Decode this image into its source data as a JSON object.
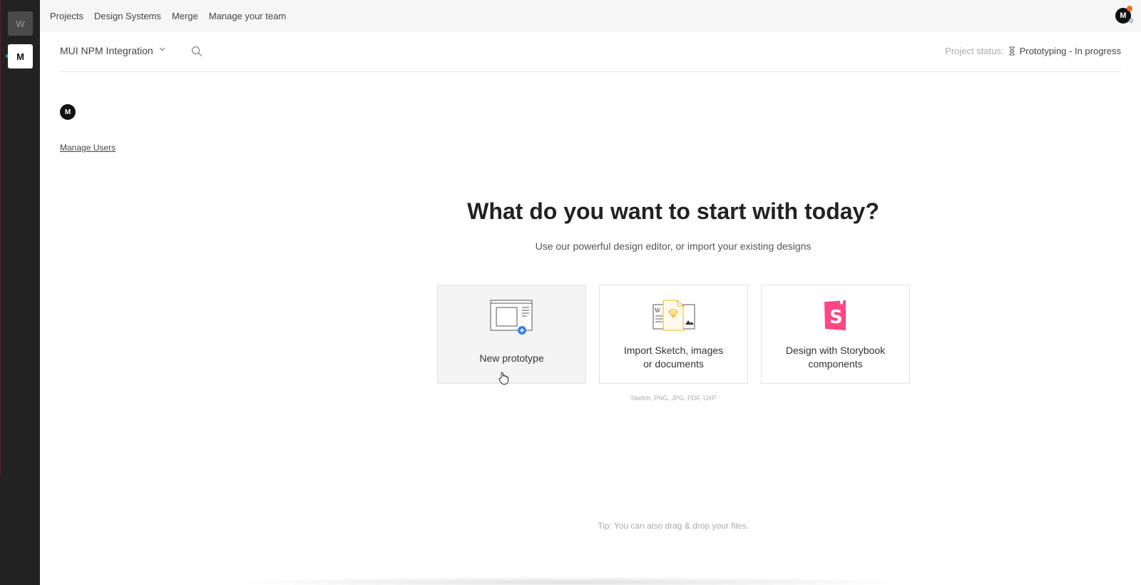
{
  "workspaces": [
    {
      "initial": "W"
    },
    {
      "initial": "M"
    }
  ],
  "topnav": {
    "items": [
      "Projects",
      "Design Systems",
      "Merge",
      "Manage your team"
    ],
    "user_initial": "M"
  },
  "project": {
    "name": "MUI NPM Integration",
    "status_label": "Project status:",
    "status_value": "Prototyping - In progress"
  },
  "members": {
    "initial": "M",
    "manage_link": "Manage Users"
  },
  "hero": {
    "title": "What do you want to start with today?",
    "subtitle": "Use our powerful design editor, or import your existing designs"
  },
  "cards": [
    {
      "label": "New prototype",
      "icon": "prototype-icon"
    },
    {
      "label": "Import Sketch, images or documents",
      "line1": "Import Sketch, images",
      "line2": "or documents",
      "icon": "import-files-icon"
    },
    {
      "label": "Design with Storybook components",
      "line1": "Design with Storybook",
      "line2": "components",
      "icon": "storybook-icon"
    }
  ],
  "import_formats": "Sketch, PNG, JPG, PDF, UXP",
  "tip": "Tip: You can also drag & drop your files.",
  "colors": {
    "accent": "#2f80ed",
    "storybook": "#ff4785",
    "notification": "#f26b21",
    "sketch": "#f7b500"
  }
}
